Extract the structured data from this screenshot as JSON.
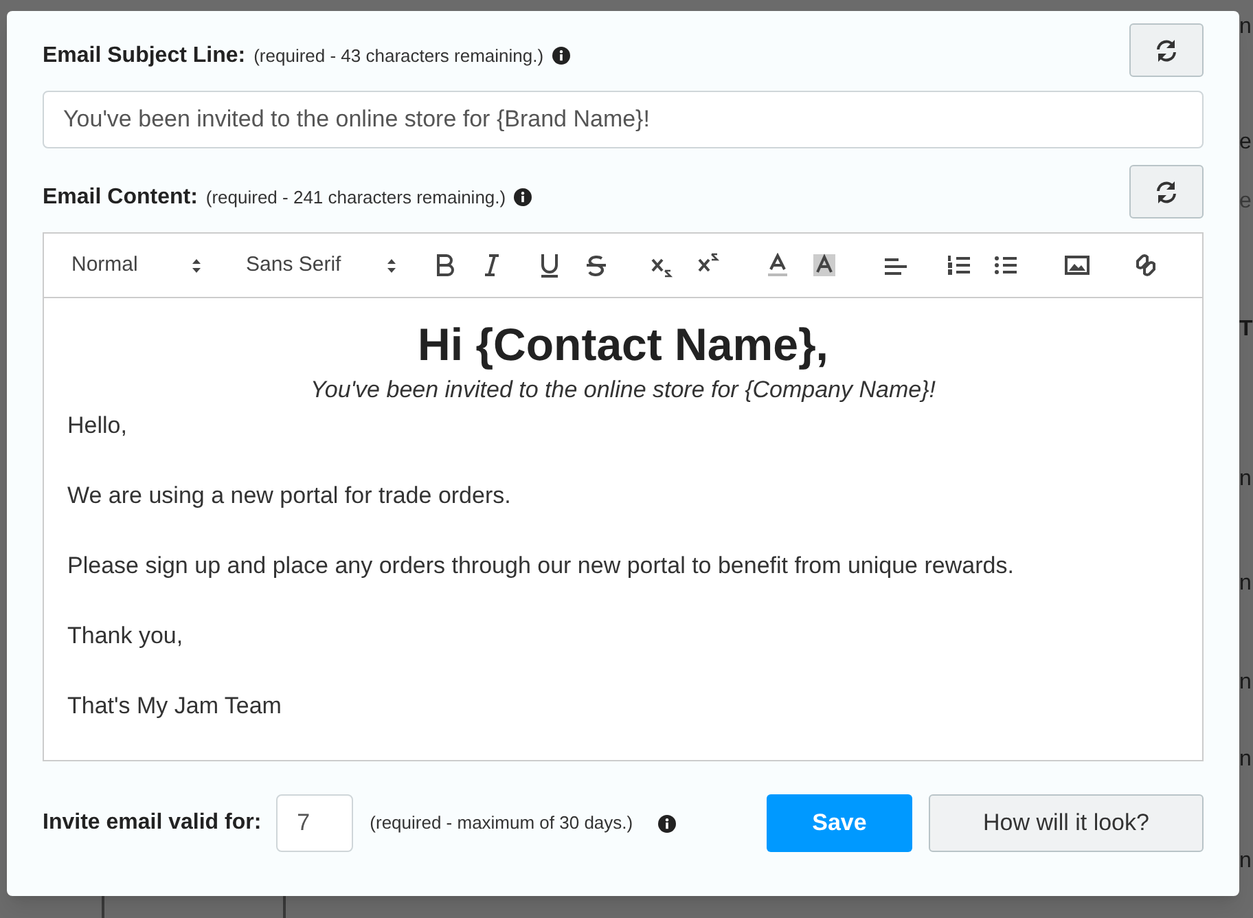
{
  "backdrop": {
    "fragments": [
      "n",
      "e",
      "e",
      "T",
      "n",
      "n",
      "n",
      "n",
      "n"
    ]
  },
  "subject": {
    "label": "Email Subject Line:",
    "hint": "(required - 43 characters remaining.)",
    "value": "You've been invited to the online store for {Brand Name}!"
  },
  "content": {
    "label": "Email Content:",
    "hint": "(required - 241 characters remaining.)",
    "toolbar": {
      "selects": [
        "Normal",
        "Sans Serif"
      ]
    },
    "body": [
      {
        "kind": "heading",
        "text": "Hi {Contact Name},"
      },
      {
        "kind": "subtitle",
        "text": "You've been invited to the online store for {Company Name}!"
      },
      {
        "kind": "paragraph",
        "text": "Hello,"
      },
      {
        "kind": "paragraph",
        "text": "We are using a new portal for trade orders."
      },
      {
        "kind": "paragraph",
        "text": "Please sign up and place any orders through our new portal to benefit from unique rewards."
      },
      {
        "kind": "paragraph",
        "text": "Thank you,"
      },
      {
        "kind": "paragraph",
        "text": "That's My Jam Team"
      }
    ]
  },
  "footer": {
    "label": "Invite email valid for:",
    "days": "7",
    "hint": "(required - maximum of 30 days.)",
    "buttons": [
      {
        "kind": "primary",
        "label": "Save"
      },
      {
        "kind": "secondary",
        "label": "How will it look?"
      }
    ]
  }
}
